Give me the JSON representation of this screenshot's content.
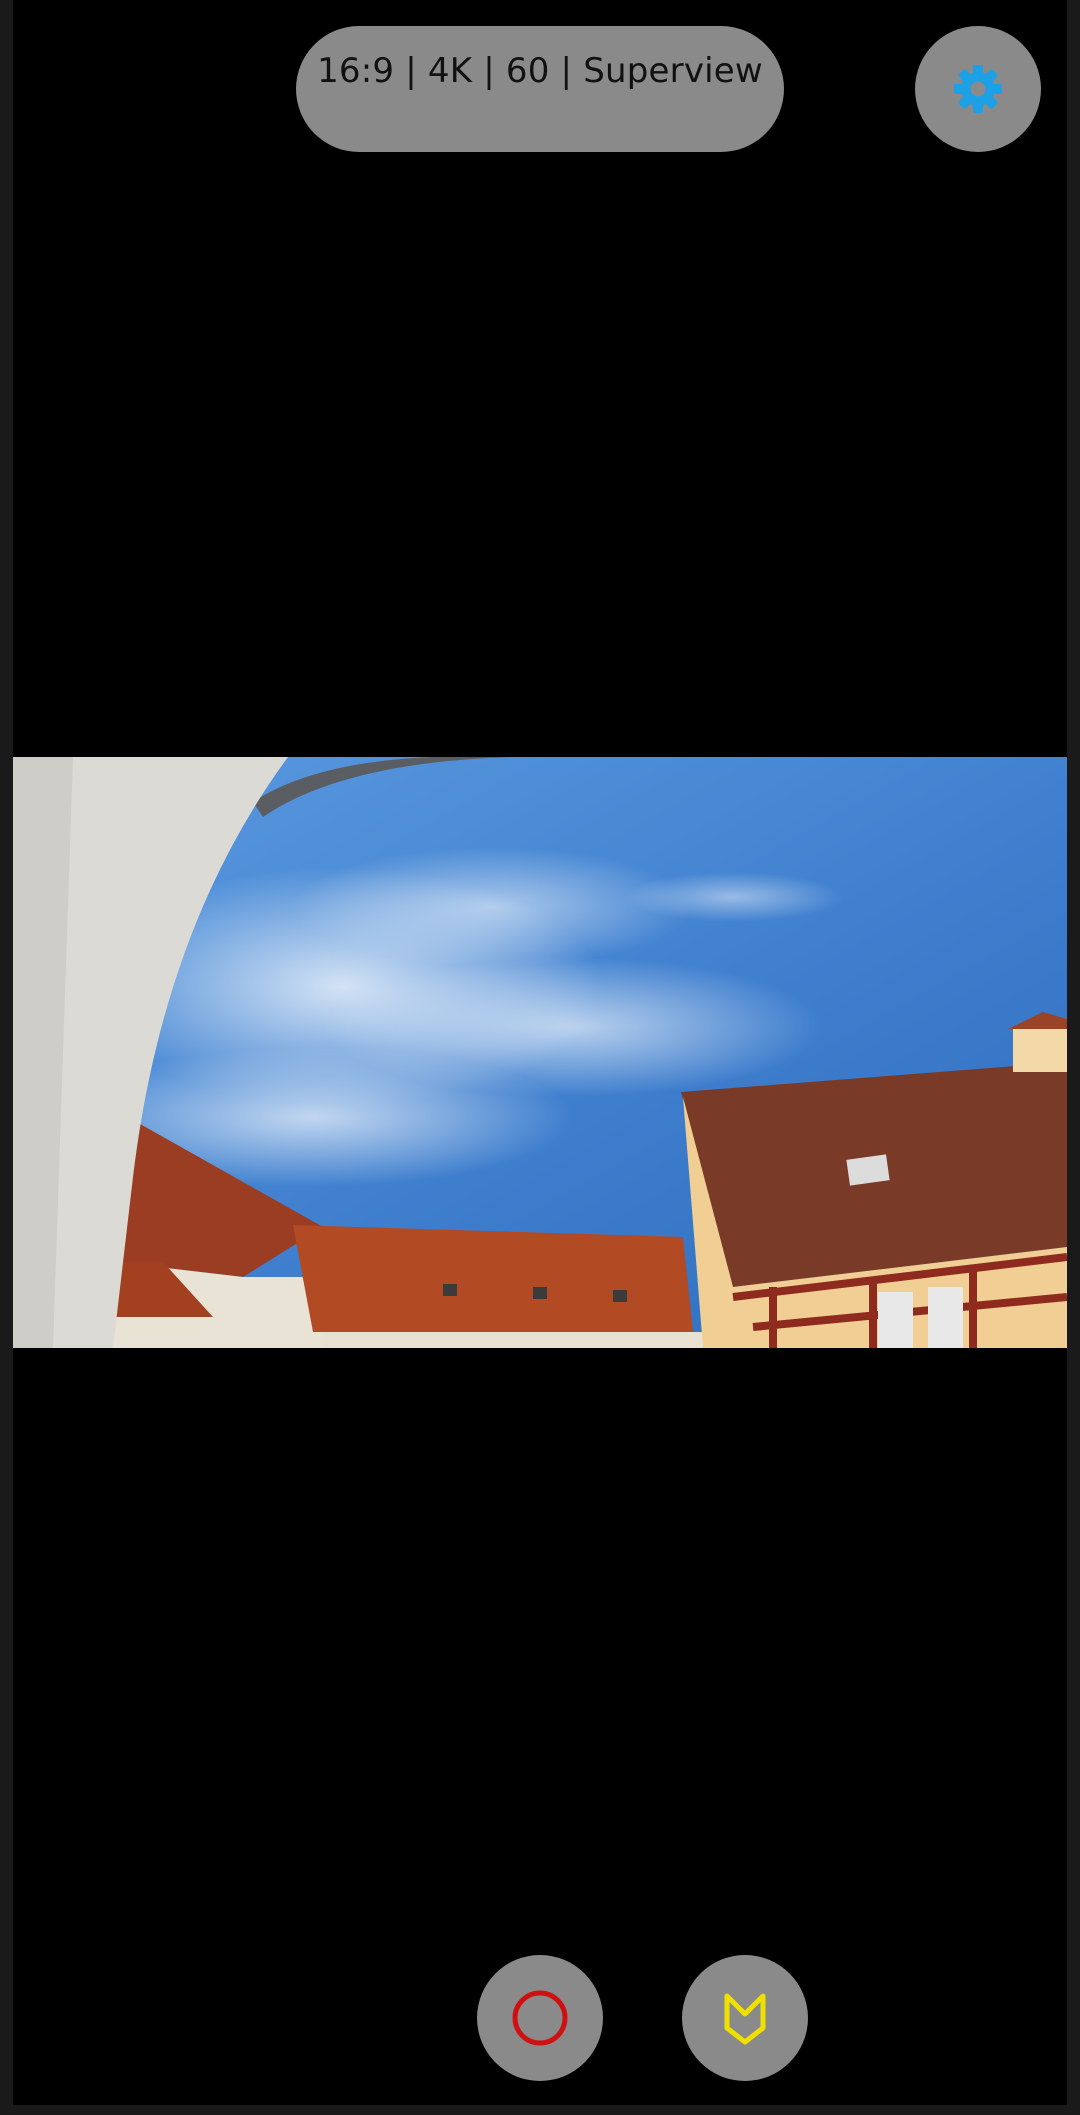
{
  "app": {
    "status_pill": "16:9 | 4K | 60 | Superview"
  },
  "icons": {
    "settings": "gear-icon",
    "record": "record-icon",
    "highlight": "hilight-tag-icon"
  },
  "colors": {
    "pill_bg": "#8a8a8a",
    "gear": "#1ea0e6",
    "record": "#d01010",
    "highlight": "#f0e000"
  }
}
